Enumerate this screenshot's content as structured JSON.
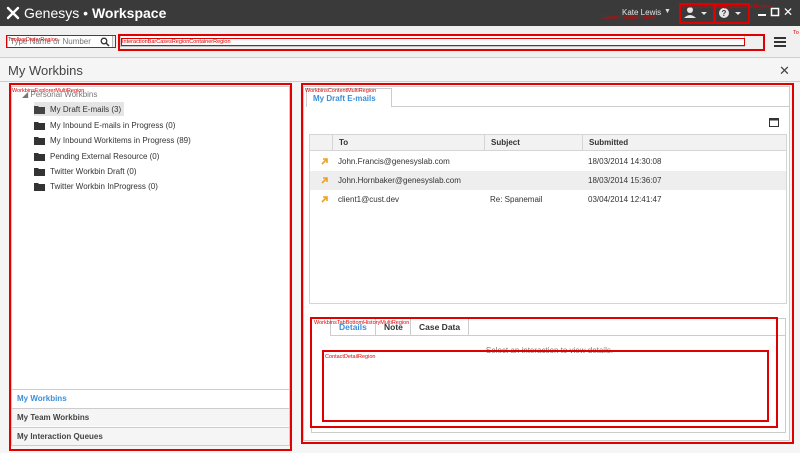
{
  "app": {
    "brand": "Genesys",
    "separator": "•",
    "name": "Workspace",
    "user_name": "Kate Lewis"
  },
  "toolbar": {
    "dialer_placeholder": "Type Name or Number"
  },
  "page": {
    "title": "My Workbins",
    "close_glyph": "✕"
  },
  "explorer": {
    "root_label": "Personal Workbins",
    "items": [
      {
        "label": "My Draft E-mails (3)"
      },
      {
        "label": "My Inbound E-mails in Progress (0)"
      },
      {
        "label": "My Inbound Workitems in Progress (89)"
      },
      {
        "label": "Pending External Resource (0)"
      },
      {
        "label": "Twitter Workbin Draft (0)"
      },
      {
        "label": "Twitter Workbin InProgress (0)"
      }
    ],
    "nav": [
      {
        "label": "My Workbins"
      },
      {
        "label": "My Team Workbins"
      },
      {
        "label": "My Interaction Queues"
      }
    ]
  },
  "content": {
    "tab_label": "My Draft E-mails",
    "columns": [
      "To",
      "Subject",
      "Submitted"
    ],
    "rows": [
      {
        "to": "John.Francis@genesyslab.com",
        "subject": "",
        "submitted": "18/03/2014 14:30:08"
      },
      {
        "to": "John.Hornbaker@genesyslab.com",
        "subject": "",
        "submitted": "18/03/2014 15:36:07"
      },
      {
        "to": "client1@cust.dev",
        "subject": "Re: Spanemail",
        "submitted": "03/04/2014 12:41:47"
      }
    ],
    "bottom_tabs": [
      {
        "label": "Details"
      },
      {
        "label": "Note"
      },
      {
        "label": "Case Data"
      }
    ],
    "hint": "Select an interaction to view details."
  },
  "regions": {
    "toolbar_dialer": "ToolbarDialerRegion",
    "interaction_bar_container": "InteractionBarCasesRegionContainerRegion",
    "custom_toolbar": "CustomToolBarRegion",
    "main_split": "MainSplitButtonRegion",
    "help_split": "HelpSplitButtonRegion",
    "toolbar_edge": "To",
    "explorer": "WorkbinsExplorerMultiRegion",
    "content": "WorkbinsContentMultiRegion",
    "tab_bottom": "WorkbinsTabBottomHistoryMultiRegion",
    "contact_detail": "ContactDetailRegion"
  },
  "colors": {
    "titlebar": "#3a3a3a",
    "accent": "#3a8fd8",
    "region_outline": "#e00000",
    "mail_icon": "#f0a020"
  },
  "icons": {
    "logo": "genesys-logo-icon",
    "agent_status": "agent-status-icon",
    "help": "help-icon",
    "search": "search-icon",
    "menu": "hamburger-menu-icon",
    "folder": "folder-icon",
    "mail": "outbound-email-icon",
    "maximize": "maximize-icon"
  }
}
